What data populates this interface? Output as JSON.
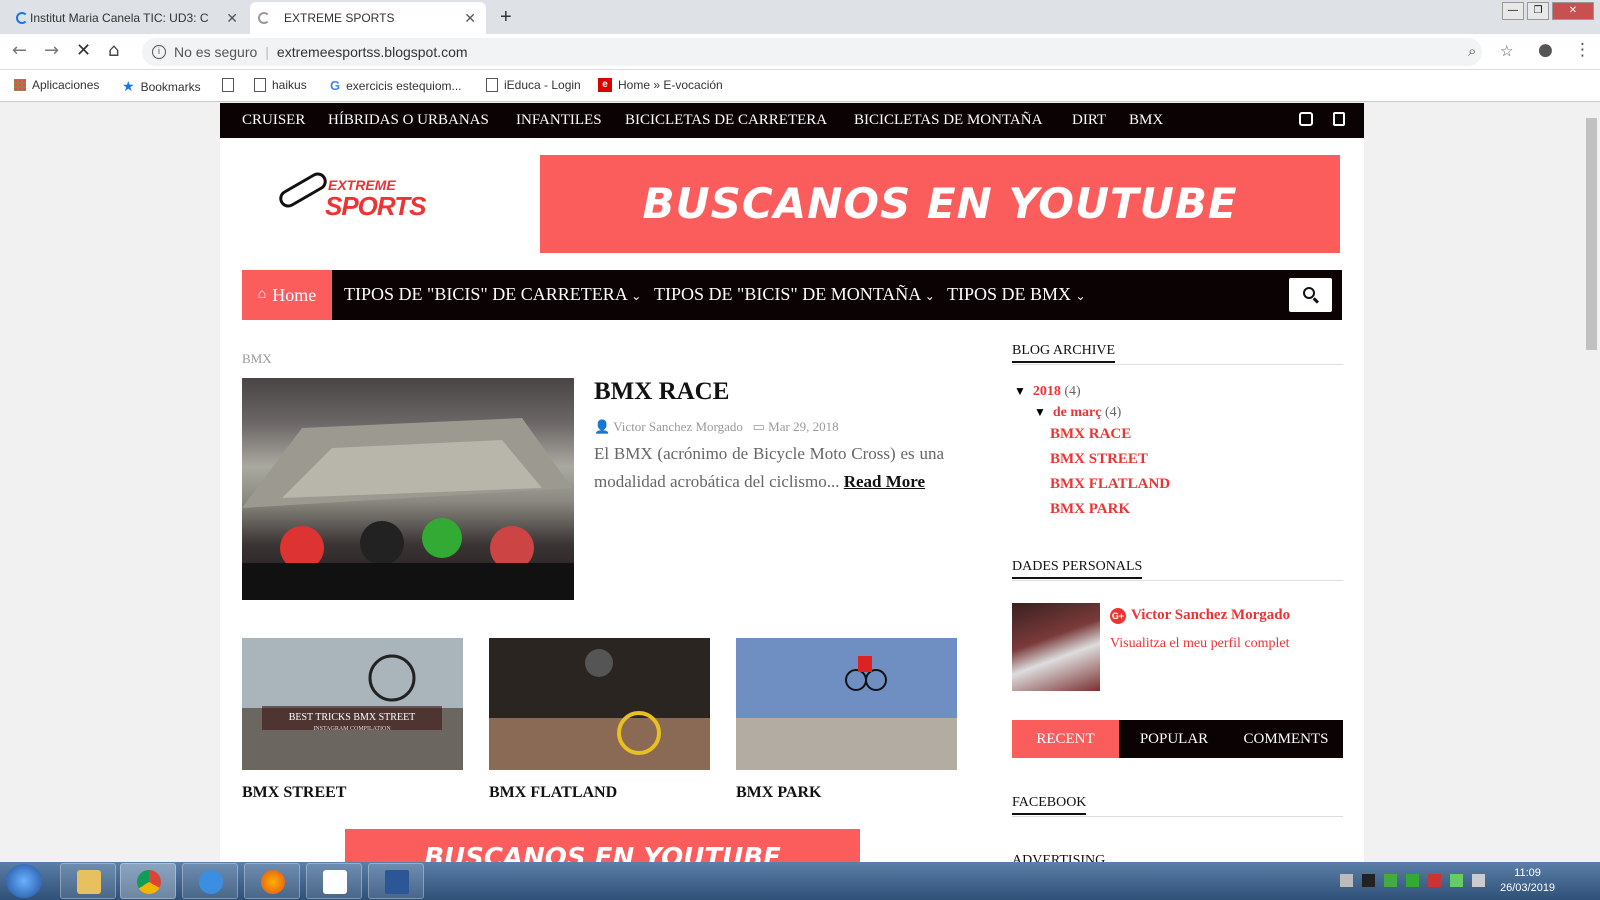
{
  "browser": {
    "tabs": [
      {
        "title": "Institut Maria Canela TIC: UD3: C"
      },
      {
        "title": "EXTREME SPORTS"
      }
    ],
    "security_text": "No es seguro",
    "url": "extremeesportss.blogspot.com",
    "bookmarks": [
      "Aplicaciones",
      "Bookmarks",
      "haikus",
      "exercicis estequiom...",
      "iEduca - Login",
      "Home » E-vocación"
    ]
  },
  "site": {
    "top_nav": [
      "CRUISER",
      "HÍBRIDAS O URBANAS",
      "INFANTILES",
      "BICICLETAS DE CARRETERA",
      "BICICLETAS DE MONTAÑA",
      "DIRT",
      "BMX"
    ],
    "logo": {
      "line1": "EXTREME",
      "line2": "SPORTS"
    },
    "banner_text": "BUSCANOS EN YOUTUBE",
    "main_nav": {
      "home": "Home",
      "items": [
        "TIPOS DE \"BICIS\" DE CARRETERA",
        "TIPOS DE \"BICIS\" DE MONTAÑA",
        "TIPOS DE BMX"
      ]
    }
  },
  "main": {
    "label": "BMX",
    "featured": {
      "title": "BMX RACE",
      "author": "Victor Sanchez Morgado",
      "date": "Mar 29, 2018",
      "excerpt": "El BMX (acrónimo de Bicycle Moto Cross) es una modalidad acrobática del ciclismo...",
      "read_more": "Read More"
    },
    "thumbs": [
      {
        "title": "BMX STREET",
        "overlay1": "BEST TRICKS BMX STREET",
        "overlay2": "INSTAGRAM COMPILATION"
      },
      {
        "title": "BMX FLATLAND"
      },
      {
        "title": "BMX PARK"
      }
    ],
    "bottom_banner": "BUSCANOS EN YOUTUBE"
  },
  "sidebar": {
    "archive_title": "BLOG ARCHIVE",
    "year": "2018",
    "year_count": "(4)",
    "month": "de març",
    "month_count": "(4)",
    "posts": [
      "BMX RACE",
      "BMX STREET",
      "BMX FLATLAND",
      "BMX PARK"
    ],
    "profile_title": "DADES PERSONALS",
    "profile_name": "Victor Sanchez Morgado",
    "profile_link": "Visualitza el meu perfil complet",
    "tabs": [
      "RECENT",
      "POPULAR",
      "COMMENTS"
    ],
    "facebook_title": "FACEBOOK",
    "advertising_title": "ADVERTISING"
  },
  "taskbar": {
    "time": "11:09",
    "date": "26/03/2019"
  },
  "colors": {
    "accent": "#fb5d5d",
    "dark": "#0b0203",
    "link": "#e33333"
  }
}
